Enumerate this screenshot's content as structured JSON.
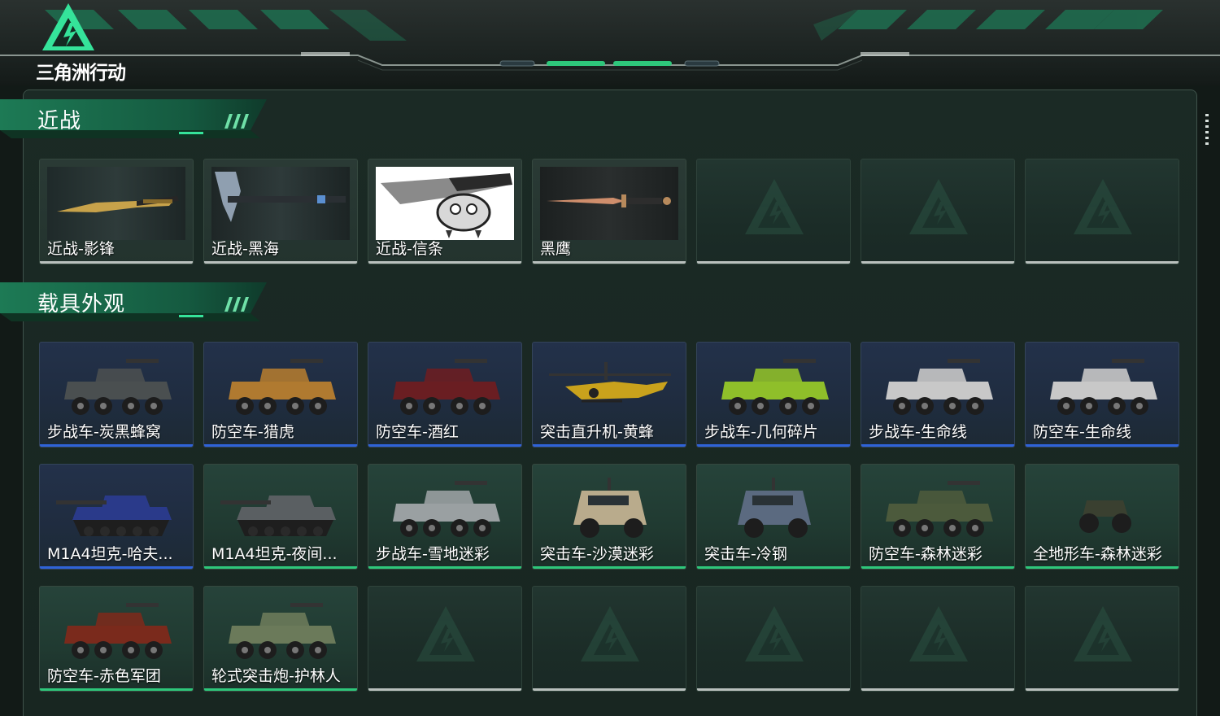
{
  "app": {
    "logo_title": "三角洲行动",
    "colors": {
      "accent_green": "#2ec77b",
      "accent_blue": "#2f63d8",
      "panel_bg": "#1b2a25"
    }
  },
  "sections": {
    "melee": {
      "title": "近战",
      "items": [
        {
          "label": "近战-影锋",
          "icon": "blade-icon"
        },
        {
          "label": "近战-黑海",
          "icon": "axe-icon"
        },
        {
          "label": "近战-信条",
          "icon": "knuckle-knife-icon"
        },
        {
          "label": "黑鹰",
          "icon": "dagger-icon"
        }
      ]
    },
    "vehicles": {
      "title": "载具外观",
      "items": [
        {
          "label": "步战车-炭黑蜂窝",
          "rarity": "blue"
        },
        {
          "label": "防空车-猎虎",
          "rarity": "blue"
        },
        {
          "label": "防空车-酒红",
          "rarity": "blue"
        },
        {
          "label": "突击直升机-黄蜂",
          "rarity": "blue"
        },
        {
          "label": "步战车-几何碎片",
          "rarity": "blue"
        },
        {
          "label": "步战车-生命线",
          "rarity": "blue"
        },
        {
          "label": "防空车-生命线",
          "rarity": "blue"
        },
        {
          "label": "M1A4坦克-哈夫...",
          "rarity": "blue"
        },
        {
          "label": "M1A4坦克-夜间...",
          "rarity": "green"
        },
        {
          "label": "步战车-雪地迷彩",
          "rarity": "green"
        },
        {
          "label": "突击车-沙漠迷彩",
          "rarity": "green"
        },
        {
          "label": "突击车-冷钢",
          "rarity": "green"
        },
        {
          "label": "防空车-森林迷彩",
          "rarity": "green"
        },
        {
          "label": "全地形车-森林迷彩",
          "rarity": "green"
        },
        {
          "label": "防空车-赤色军团",
          "rarity": "green"
        },
        {
          "label": "轮式突击炮-护林人",
          "rarity": "green"
        }
      ]
    }
  }
}
